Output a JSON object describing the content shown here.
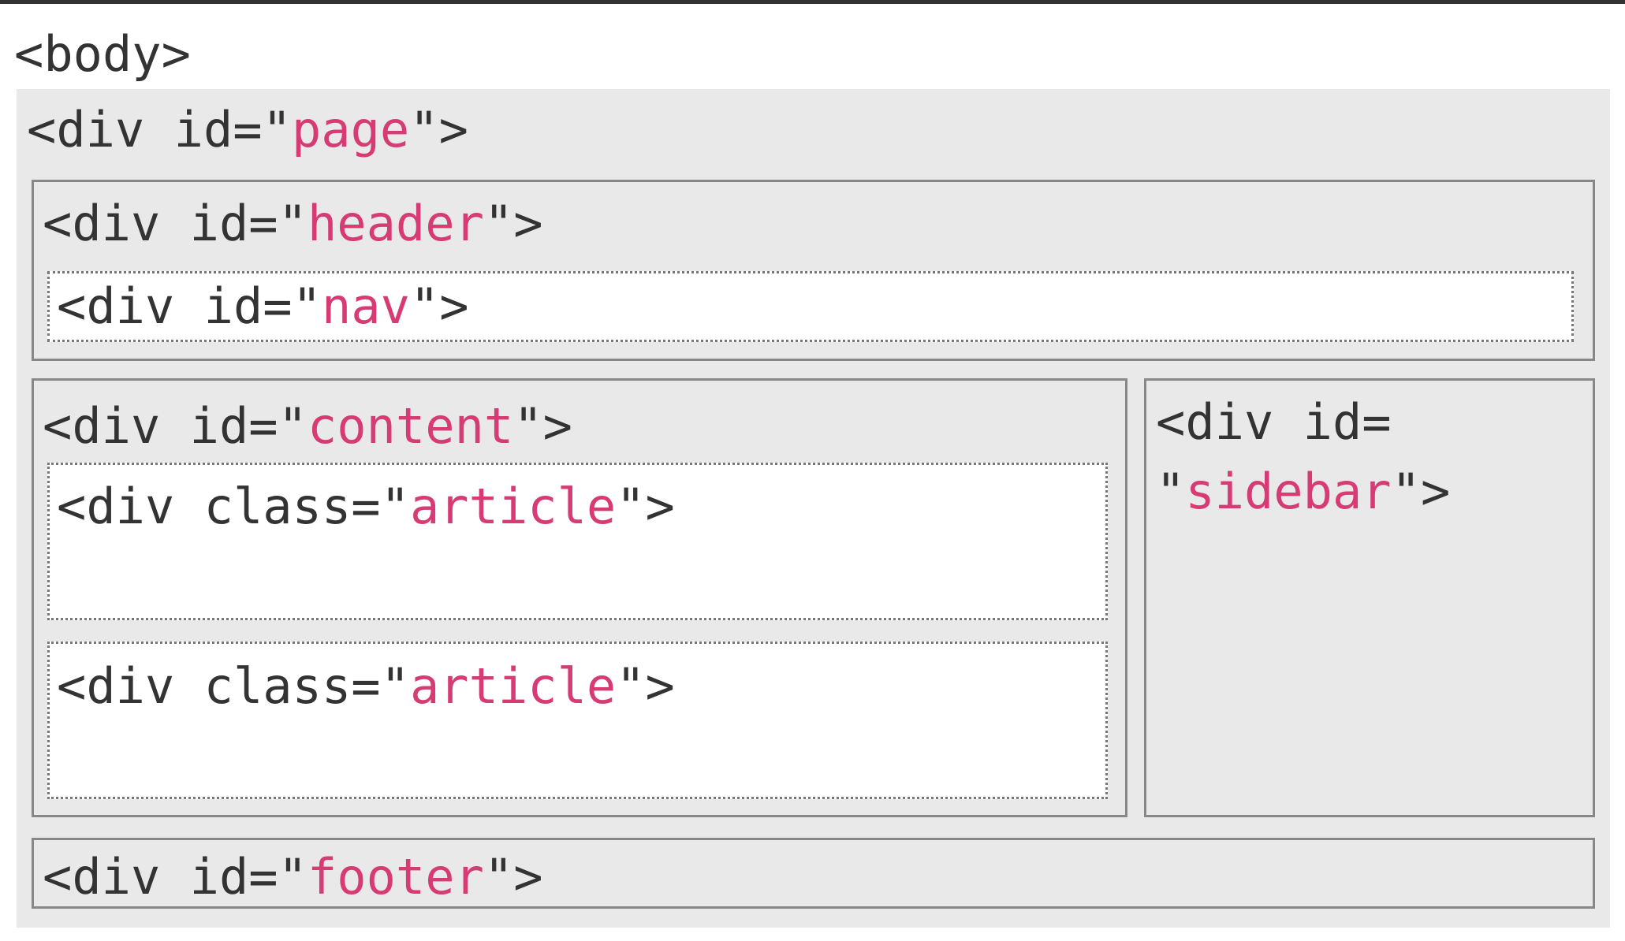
{
  "colors": {
    "tag": "#333333",
    "value": "#d63b74",
    "panel": "#e9e9e9",
    "border": "#888888"
  },
  "body": {
    "tag": "<body>"
  },
  "page": {
    "pre": "<div id=\"",
    "value": "page",
    "post": "\">"
  },
  "header": {
    "pre": "<div id=\"",
    "value": "header",
    "post": "\">"
  },
  "nav": {
    "pre": "<div id=\"",
    "value": "nav",
    "post": "\">"
  },
  "content": {
    "pre": "<div id=\"",
    "value": "content",
    "post": "\">"
  },
  "articles": [
    {
      "pre": "<div class=\"",
      "value": "article",
      "post": "\">"
    },
    {
      "pre": "<div class=\"",
      "value": "article",
      "post": "\">"
    }
  ],
  "sidebar": {
    "line1": "<div id=",
    "pre": "\"",
    "value": "sidebar",
    "post": "\">"
  },
  "footer": {
    "pre": "<div id=\"",
    "value": "footer",
    "post": "\">"
  }
}
